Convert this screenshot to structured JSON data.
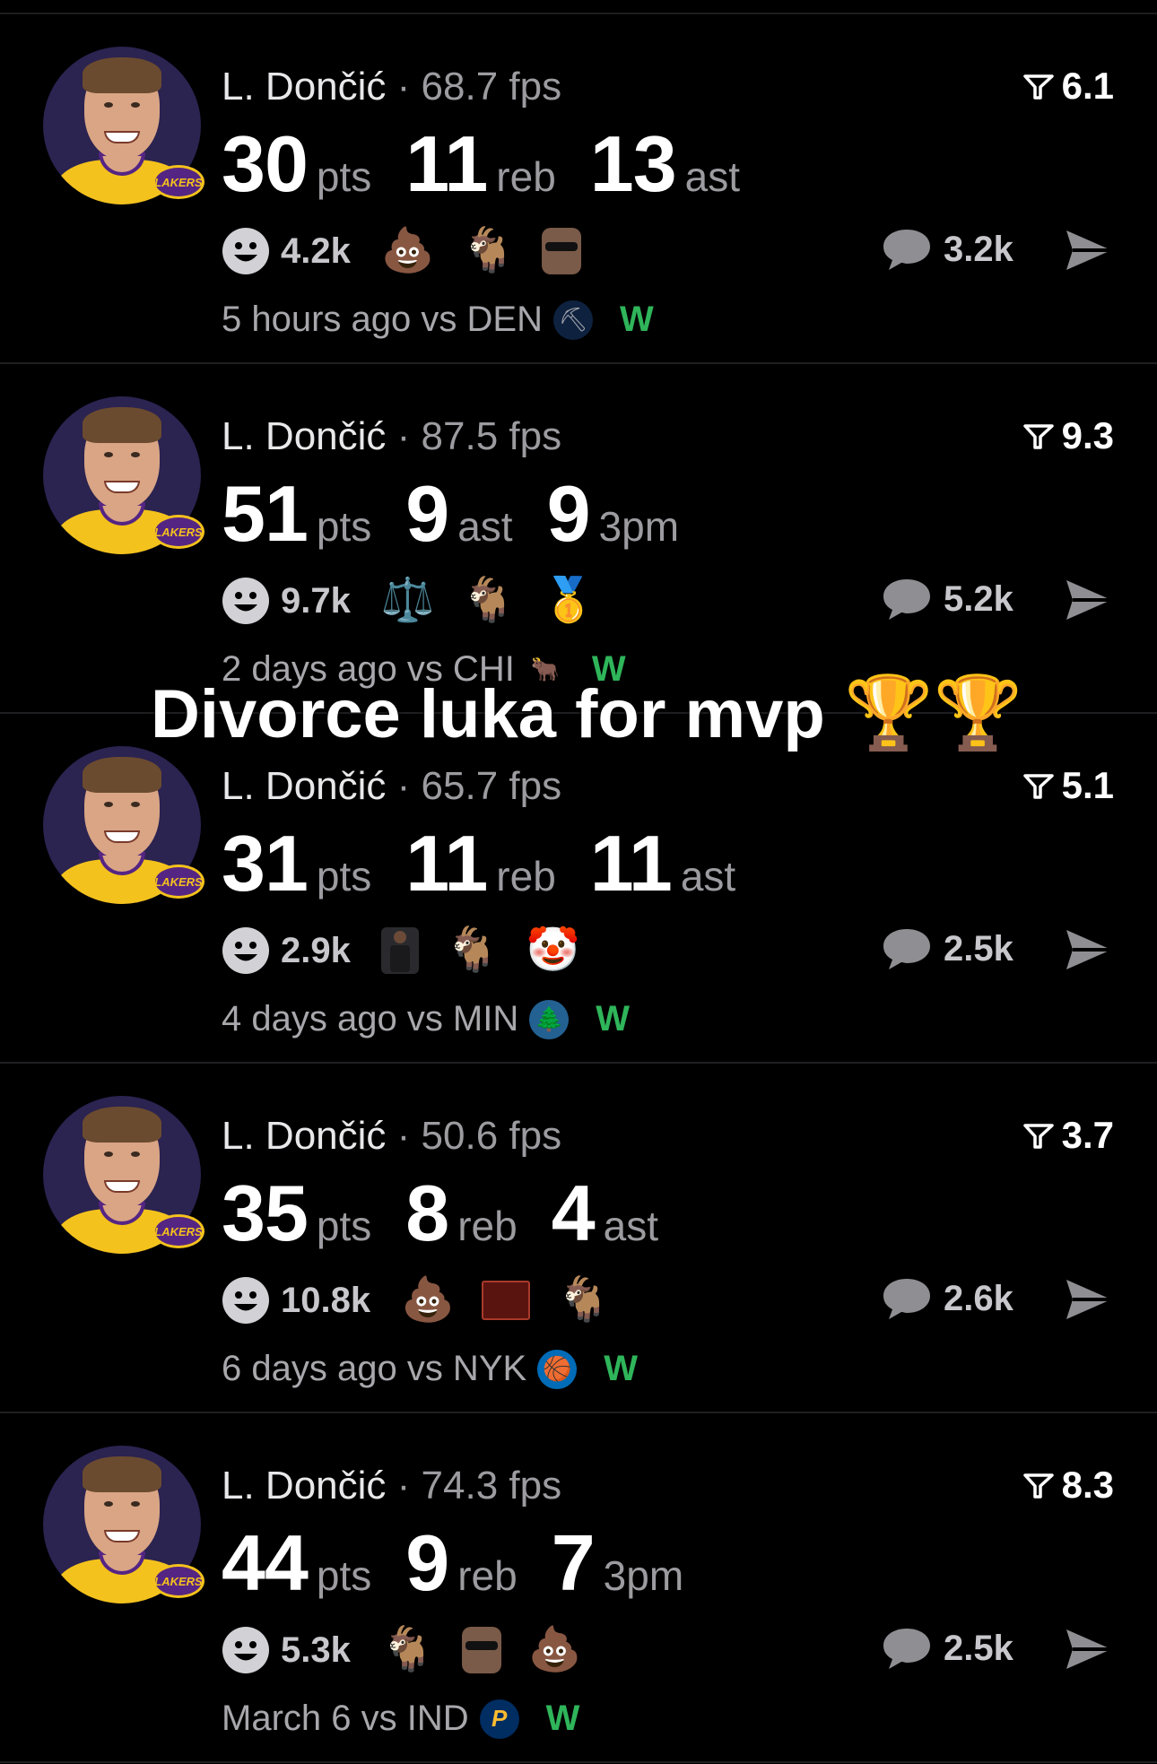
{
  "caption": {
    "text": "Divorce luka for mvp",
    "emoji": "🏆🏆"
  },
  "team_badge": "LAKERS",
  "posts": [
    {
      "player": "L. Dončić",
      "sep": " · ",
      "fps": "68.7 fps",
      "score": "6.1",
      "stats": [
        {
          "n": "30",
          "u": "pts"
        },
        {
          "n": "11",
          "u": "reb"
        },
        {
          "n": "13",
          "u": "ast"
        }
      ],
      "likes": "4.2k",
      "emojis": [
        "💩",
        "🐐",
        "face"
      ],
      "comments": "3.2k",
      "when": "5 hours ago vs DEN",
      "opp_logo": "⛏",
      "opp_color": "#0e2240",
      "result": "W"
    },
    {
      "player": "L. Dončić",
      "sep": " · ",
      "fps": "87.5 fps",
      "score": "9.3",
      "stats": [
        {
          "n": "51",
          "u": "pts"
        },
        {
          "n": "9",
          "u": "ast"
        },
        {
          "n": "9",
          "u": "3pm"
        }
      ],
      "likes": "9.7k",
      "emojis": [
        "⚖️",
        "🐐",
        "🥇"
      ],
      "comments": "5.2k",
      "when": "2 days ago vs CHI",
      "opp_logo": "🐂",
      "opp_color": "#000000",
      "result": "W"
    },
    {
      "player": "L. Dončić",
      "sep": " · ",
      "fps": "65.7 fps",
      "score": "5.1",
      "stats": [
        {
          "n": "31",
          "u": "pts"
        },
        {
          "n": "11",
          "u": "reb"
        },
        {
          "n": "11",
          "u": "ast"
        }
      ],
      "likes": "2.9k",
      "emojis": [
        "player",
        "🐐",
        "🤡"
      ],
      "comments": "2.5k",
      "when": "4 days ago vs MIN",
      "opp_logo": "🌲",
      "opp_color": "#236192",
      "result": "W"
    },
    {
      "player": "L. Dončić",
      "sep": " · ",
      "fps": "50.6 fps",
      "score": "3.7",
      "stats": [
        {
          "n": "35",
          "u": "pts"
        },
        {
          "n": "8",
          "u": "reb"
        },
        {
          "n": "4",
          "u": "ast"
        }
      ],
      "likes": "10.8k",
      "emojis": [
        "💩",
        "poster",
        "🐐"
      ],
      "comments": "2.6k",
      "when": "6 days ago vs NYK",
      "opp_logo": "🏀",
      "opp_color": "#006bb6",
      "result": "W"
    },
    {
      "player": "L. Dončić",
      "sep": " · ",
      "fps": "74.3 fps",
      "score": "8.3",
      "stats": [
        {
          "n": "44",
          "u": "pts"
        },
        {
          "n": "9",
          "u": "reb"
        },
        {
          "n": "7",
          "u": "3pm"
        }
      ],
      "likes": "5.3k",
      "emojis": [
        "🐐",
        "face",
        "💩"
      ],
      "comments": "2.5k",
      "when": "March 6 vs IND",
      "opp_logo": "P",
      "opp_color": "#002d62",
      "result": "W"
    }
  ]
}
